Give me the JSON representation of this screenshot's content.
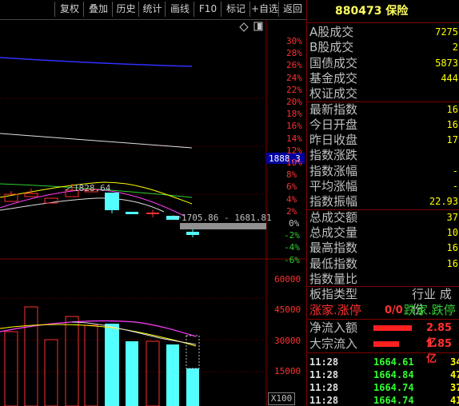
{
  "toolbar": {
    "buttons": [
      "复权",
      "叠加",
      "历史",
      "统计",
      "画线",
      "F10",
      "标记",
      "+自选",
      "返回"
    ]
  },
  "chart": {
    "pct_labels_red": [
      "30%",
      "28%",
      "26%",
      "24%",
      "22%",
      "20%",
      "18%",
      "16%",
      "14%",
      "12%",
      "10%",
      "8%",
      "6%",
      "4%",
      "2%"
    ],
    "pct_zero": "0%",
    "pct_labels_green": [
      "-2%",
      "-4%",
      "-6%"
    ],
    "price_flag": "1888.3",
    "high_annotation": "1828.64",
    "range_annotation": "1705.86 - 1681.81",
    "volume_labels": [
      "60000",
      "45000",
      "30000",
      "15000"
    ],
    "volume_unit": "X100",
    "colors": {
      "up": "#ff3030",
      "down": "#54ffff",
      "ma_white": "#e0e0e0",
      "ma_yellow": "#ffff00",
      "ma_magenta": "#ff40ff",
      "ma_green": "#30d030",
      "ma_blue": "#3030ff"
    }
  },
  "panel": {
    "title": "880473 保险",
    "rows": [
      {
        "label": "A股成交",
        "value": "7275"
      },
      {
        "label": "B股成交",
        "value": "2"
      },
      {
        "label": "国债成交",
        "value": "5873"
      },
      {
        "label": "基金成交",
        "value": "444"
      },
      {
        "label": "权证成交",
        "value": ""
      },
      {
        "label": "最新指数",
        "value": "16"
      },
      {
        "label": "今日开盘",
        "value": "16"
      },
      {
        "label": "昨日收盘",
        "value": "17"
      },
      {
        "label": "指数涨跌",
        "value": ""
      },
      {
        "label": "指数涨幅",
        "value": "-"
      },
      {
        "label": "平均涨幅",
        "value": "-"
      },
      {
        "label": "指数振幅",
        "value": "22.93"
      },
      {
        "label": "总成交额",
        "value": "37"
      },
      {
        "label": "总成交量",
        "value": "10"
      },
      {
        "label": "最高指数",
        "value": "16"
      },
      {
        "label": "最低指数",
        "value": "16"
      },
      {
        "label": "指数量比",
        "value": ""
      }
    ],
    "type_label": "板指类型",
    "type_value": "行业 成份",
    "updown_label": "涨家.涨停",
    "updown_value": "0/0",
    "fall_label": "跌家.跌停",
    "netflow_label": "净流入额",
    "netflow_value": "2.85亿",
    "bigflow_label": "大宗流入",
    "bigflow_value": "1.85亿",
    "ticks": [
      {
        "time": "11:28",
        "price": "1664.61",
        "vol": "34"
      },
      {
        "time": "11:28",
        "price": "1664.84",
        "vol": "47"
      },
      {
        "time": "11:28",
        "price": "1664.74",
        "vol": "37"
      },
      {
        "time": "11:28",
        "price": "1664.74",
        "vol": "41"
      }
    ]
  }
}
